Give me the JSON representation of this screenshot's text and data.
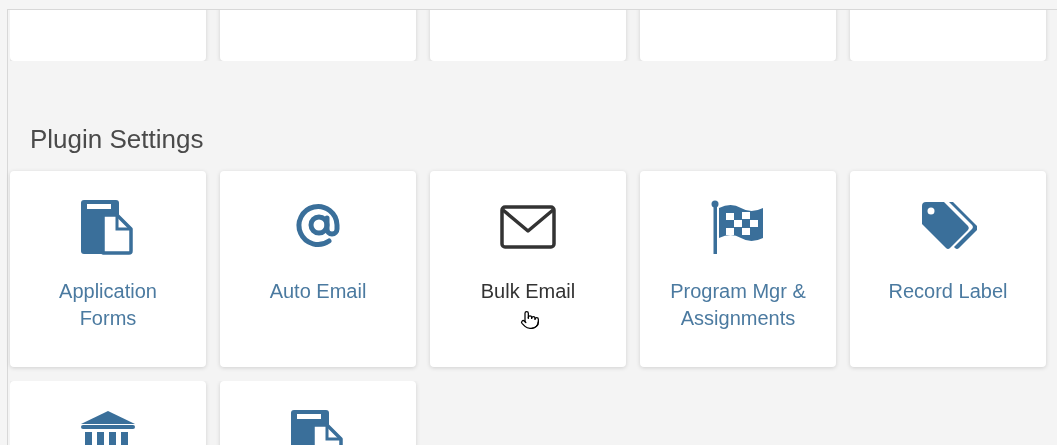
{
  "top_row": [
    {
      "kind": "card"
    },
    {
      "kind": "card"
    },
    {
      "kind": "card"
    },
    {
      "kind": "card"
    },
    {
      "kind": "card"
    }
  ],
  "section": {
    "title": "Plugin Settings",
    "cards": [
      {
        "kind": "forms",
        "label": "Application Forms",
        "hovered": false
      },
      {
        "kind": "at",
        "label": "Auto Email",
        "hovered": false
      },
      {
        "kind": "envelope",
        "label": "Bulk Email",
        "hovered": true
      },
      {
        "kind": "flag",
        "label": "Program Mgr & Assignments",
        "hovered": false
      },
      {
        "kind": "tags",
        "label": "Record Label",
        "hovered": false
      }
    ],
    "next_row": [
      {
        "kind": "bank"
      },
      {
        "kind": "forms"
      }
    ]
  }
}
